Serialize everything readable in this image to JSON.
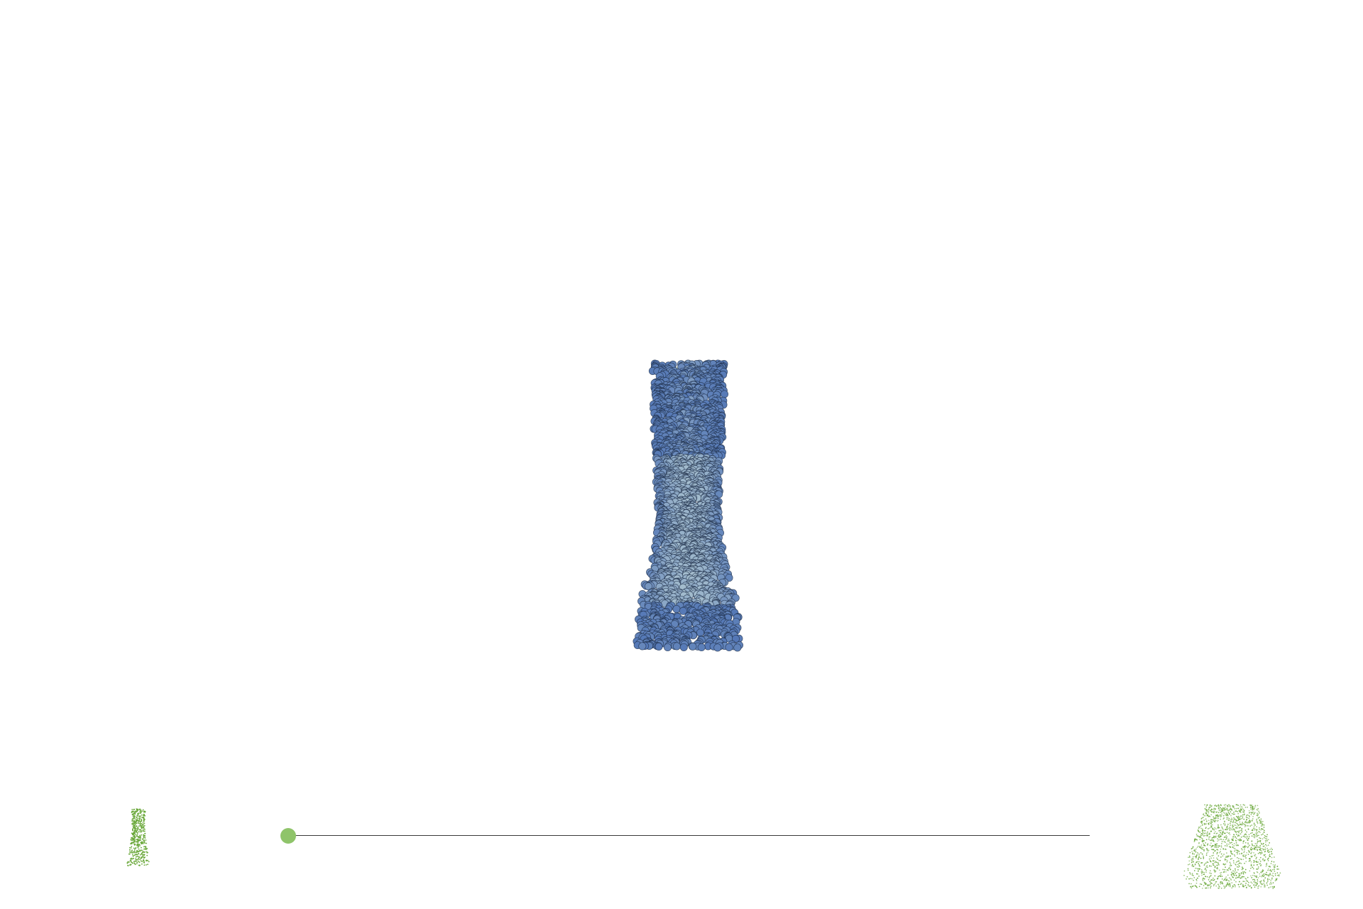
{
  "viewer": {
    "main_object": {
      "icon": "vase-point-cloud",
      "color_dark": "#4a6fb3",
      "color_light": "#a9c1cf",
      "color_outline": "#1f2f4a"
    },
    "thumbnail_start": {
      "icon": "tall-vase-point-cloud",
      "color": "#6aa83a"
    },
    "thumbnail_end": {
      "icon": "bowl-point-cloud",
      "color": "#6aa83a"
    },
    "slider": {
      "value": 0,
      "handle_color": "#8fc46a",
      "track_color": "#3a3a3a"
    }
  }
}
